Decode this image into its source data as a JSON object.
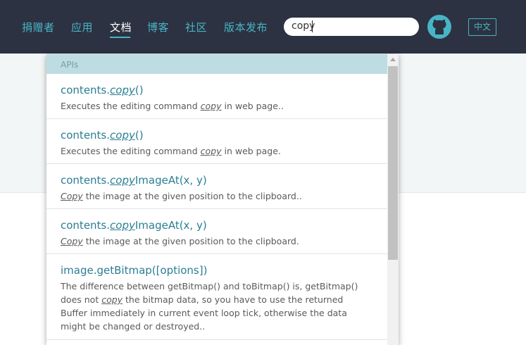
{
  "nav": {
    "items": [
      {
        "label": "捐赠者"
      },
      {
        "label": "应用"
      },
      {
        "label": "文档",
        "active": true
      },
      {
        "label": "博客"
      },
      {
        "label": "社区"
      },
      {
        "label": "版本发布"
      }
    ]
  },
  "search": {
    "value": "copy"
  },
  "header_icons": {
    "github": "github-icon"
  },
  "lang_button": {
    "label": "中文"
  },
  "dropdown": {
    "section_label": "APIs",
    "results": [
      {
        "title_prefix": "contents.",
        "title_match": "copy",
        "title_suffix": "()",
        "desc": [
          {
            "t": "Executes the editing command "
          },
          {
            "m": "copy"
          },
          {
            "t": " in web page.."
          }
        ]
      },
      {
        "title_prefix": "contents.",
        "title_match": "copy",
        "title_suffix": "()",
        "desc": [
          {
            "t": "Executes the editing command "
          },
          {
            "m": "copy"
          },
          {
            "t": " in web page."
          }
        ]
      },
      {
        "title_prefix": "contents.",
        "title_match": "copy",
        "title_suffix": "ImageAt(x, y)",
        "desc": [
          {
            "m": "Copy"
          },
          {
            "t": " the image at the given position to the clipboard.."
          }
        ]
      },
      {
        "title_prefix": "contents.",
        "title_match": "copy",
        "title_suffix": "ImageAt(x, y)",
        "desc": [
          {
            "m": "Copy"
          },
          {
            "t": " the image at the given position to the clipboard."
          }
        ]
      },
      {
        "title_prefix": "image.getBitmap([options])",
        "title_match": "",
        "title_suffix": "",
        "desc": [
          {
            "t": "The difference between getBitmap() and toBitmap() is, getBitmap() does not "
          },
          {
            "m": "copy"
          },
          {
            "t": " the bitmap data, so you have to use the returned Buffer immediately in current event loop tick, otherwise the data might be changed or destroyed.."
          }
        ]
      }
    ]
  },
  "colors": {
    "nav_bg": "#2c3241",
    "accent": "#48b4c6",
    "link": "#2a7e93",
    "section_bg": "#bddde3"
  }
}
